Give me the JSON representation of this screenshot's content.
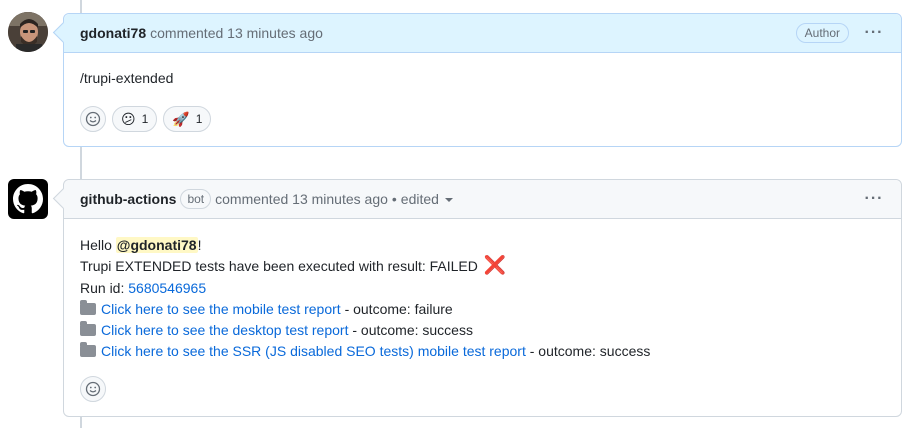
{
  "comment1": {
    "author": "gdonati78",
    "meta": "commented 13 minutes ago",
    "author_badge": "Author",
    "body": "/trupi-extended",
    "reactions": [
      {
        "emoji": "😕",
        "count": "1"
      },
      {
        "emoji": "🚀",
        "count": "1"
      }
    ]
  },
  "comment2": {
    "author": "github-actions",
    "bot_label": "bot",
    "meta": "commented 13 minutes ago",
    "edited": "edited",
    "separator": "•",
    "greeting_prefix": "Hello",
    "mention": "@gdonati78",
    "greeting_suffix": "!",
    "result_line": "Trupi EXTENDED tests have been executed with result: FAILED",
    "result_icon": "❌",
    "run_id_label": "Run id:",
    "run_id": "5680546965",
    "reports": [
      {
        "link": "Click here to see the mobile test report",
        "outcome": "- outcome: failure"
      },
      {
        "link": "Click here to see the desktop test report",
        "outcome": "- outcome: success"
      },
      {
        "link": "Click here to see the SSR (JS disabled SEO tests) mobile test report",
        "outcome": "- outcome: success"
      }
    ]
  },
  "colors": {
    "link": "#0969da",
    "author_header": "#ddf4ff",
    "mention_bg": "#fff8c5",
    "failure": "#e00000"
  }
}
